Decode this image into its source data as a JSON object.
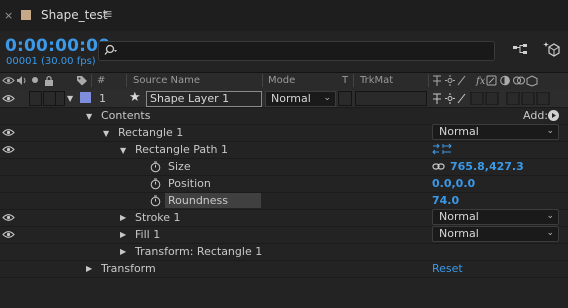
{
  "tab": {
    "close_glyph": "×",
    "title": "Shape_test",
    "menu_glyph": "≡",
    "swatch_color": "#c7a98a"
  },
  "header": {
    "timecode": "0:00:00:00",
    "frame_info": "00001 (30.00 fps)",
    "search_placeholder": "",
    "accent_color": "#3b99e8"
  },
  "columns": {
    "number": "#",
    "source_name": "Source Name",
    "mode": "Mode",
    "t": "T",
    "trkmat": "TrkMat",
    "switch_fx": "fx"
  },
  "layer": {
    "number": "1",
    "name": "Shape Layer 1",
    "label_color": "#7f8edc",
    "mode": "Normal"
  },
  "tree": {
    "contents_label": "Contents",
    "add_label": "Add:",
    "rectangle_label": "Rectangle 1",
    "rectangle_blend": "Normal",
    "path_label": "Rectangle Path 1",
    "size_label": "Size",
    "size_value": "765.8,427.3",
    "position_label": "Position",
    "position_value": "0.0,0.0",
    "roundness_label": "Roundness",
    "roundness_value": "74.0",
    "stroke_label": "Stroke 1",
    "stroke_blend": "Normal",
    "fill_label": "Fill 1",
    "fill_blend": "Normal",
    "transform_rect_label": "Transform: Rectangle 1",
    "transform_label": "Transform",
    "reset_label": "Reset"
  }
}
